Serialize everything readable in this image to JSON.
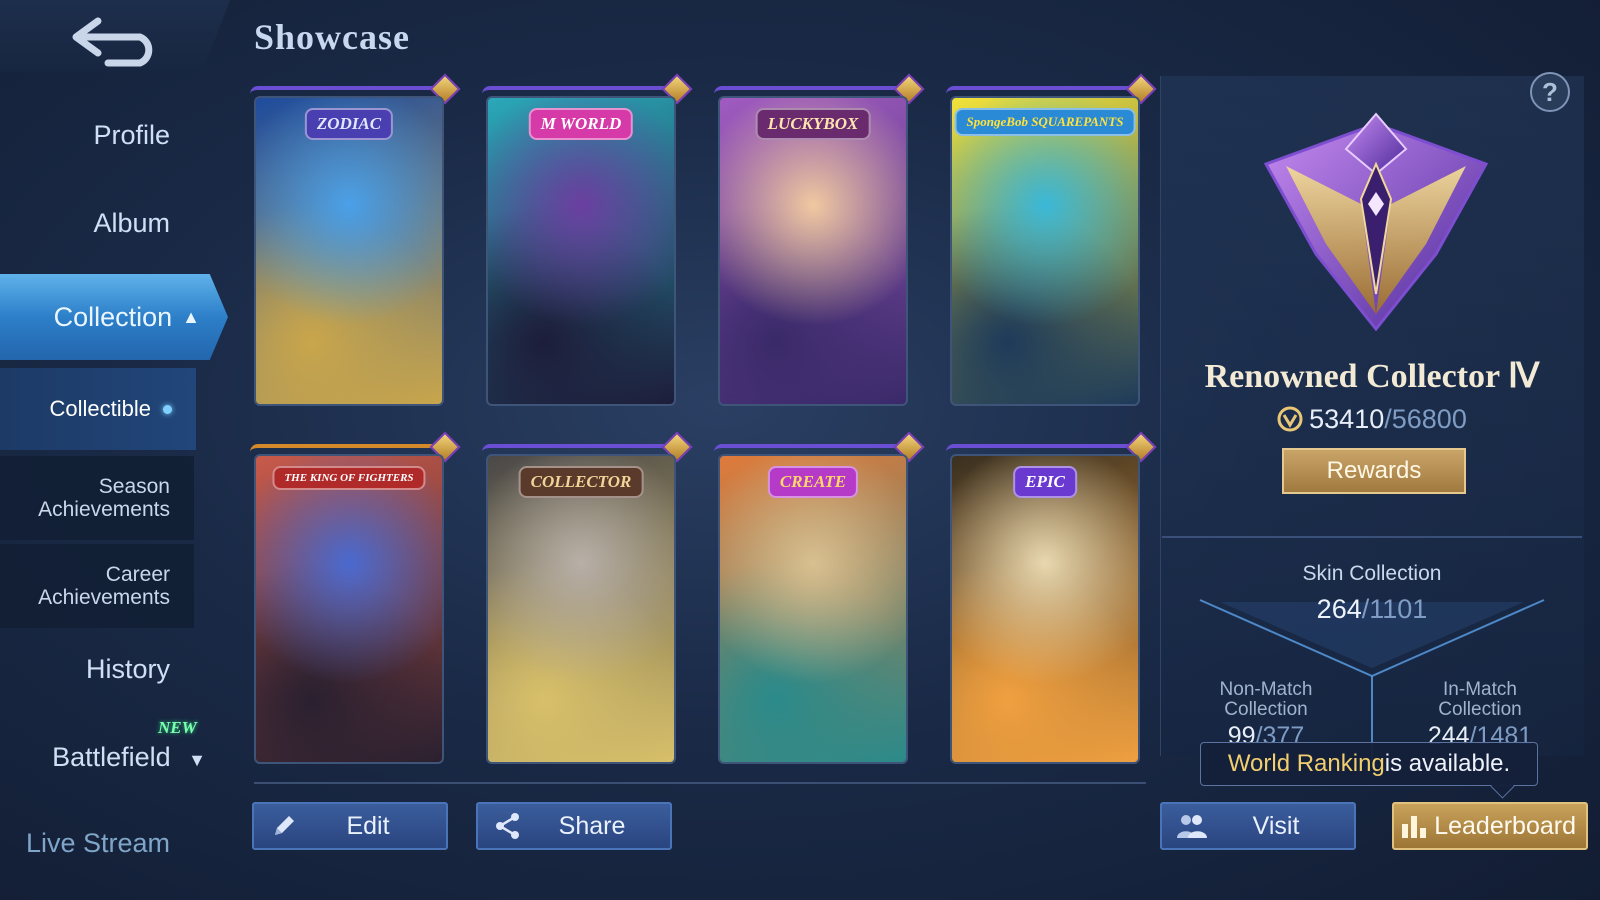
{
  "nav": {
    "profile": "Profile",
    "album": "Album",
    "collection": "Collection",
    "collectible": "Collectible",
    "season_1": "Season",
    "season_2": "Achievements",
    "career_1": "Career",
    "career_2": "Achievements",
    "history": "History",
    "battlefield": "Battlefield",
    "new_badge": "NEW",
    "live_stream": "Live Stream"
  },
  "header": {
    "title": "Showcase"
  },
  "cards": [
    {
      "badge": "ZODIAC",
      "badge_color": "#4a3fb0",
      "text_color": "#dfe8ff",
      "bg": [
        "#4aa0e8",
        "#1e4c9e",
        "#c9a64b"
      ]
    },
    {
      "badge": "M WORLD",
      "badge_color": "#d63aa8",
      "text_color": "#ffffff",
      "bg": [
        "#6b3fa0",
        "#2aa8b8",
        "#1d1d3a"
      ]
    },
    {
      "badge": "LUCKYBOX",
      "badge_color": "#6a2a6e",
      "text_color": "#ffe6b0",
      "bg": [
        "#f0c9a0",
        "#a05bc0",
        "#3a2a6a"
      ]
    },
    {
      "badge": "SpongeBob SQUAREPANTS",
      "badge_color": "#2a8ad6",
      "text_color": "#ffe23a",
      "bg": [
        "#3ab8d8",
        "#f2e23a",
        "#1d3a5a"
      ]
    },
    {
      "badge": "THE KING OF FIGHTERS",
      "badge_color": "#b02a2a",
      "text_color": "#ffffff",
      "bg": [
        "#4a6ad0",
        "#c85a4a",
        "#2a2030"
      ]
    },
    {
      "badge": "COLLECTOR",
      "badge_color": "#5a3a2a",
      "text_color": "#f1d49a",
      "bg": [
        "#b8b0a8",
        "#4a4848",
        "#d8c06a"
      ]
    },
    {
      "badge": "CREATE",
      "badge_color": "#b63ac8",
      "text_color": "#ffd86a",
      "bg": [
        "#d8c090",
        "#e07a3a",
        "#2a8a8a"
      ]
    },
    {
      "badge": "EPIC",
      "badge_color": "#6a3ad0",
      "text_color": "#ffffff",
      "bg": [
        "#e8d8b0",
        "#3a3020",
        "#f0a040"
      ]
    }
  ],
  "toolbar": {
    "edit": "Edit",
    "share": "Share",
    "visit": "Visit",
    "leaderboard": "Leaderboard"
  },
  "rank": {
    "title": "Renowned Collector Ⅳ",
    "points": "53410",
    "points_max": "56800",
    "rewards": "Rewards"
  },
  "skins": {
    "label": "Skin Collection",
    "value": "264",
    "total": "1101",
    "non_match_1": "Non-Match",
    "non_match_2": "Collection",
    "non_match_val": "99",
    "non_match_total": "377",
    "in_match_1": "In-Match",
    "in_match_2": "Collection",
    "in_match_val": "244",
    "in_match_total": "1481"
  },
  "tooltip": {
    "highlight": "World Ranking",
    "rest": " is available."
  },
  "help": "?"
}
